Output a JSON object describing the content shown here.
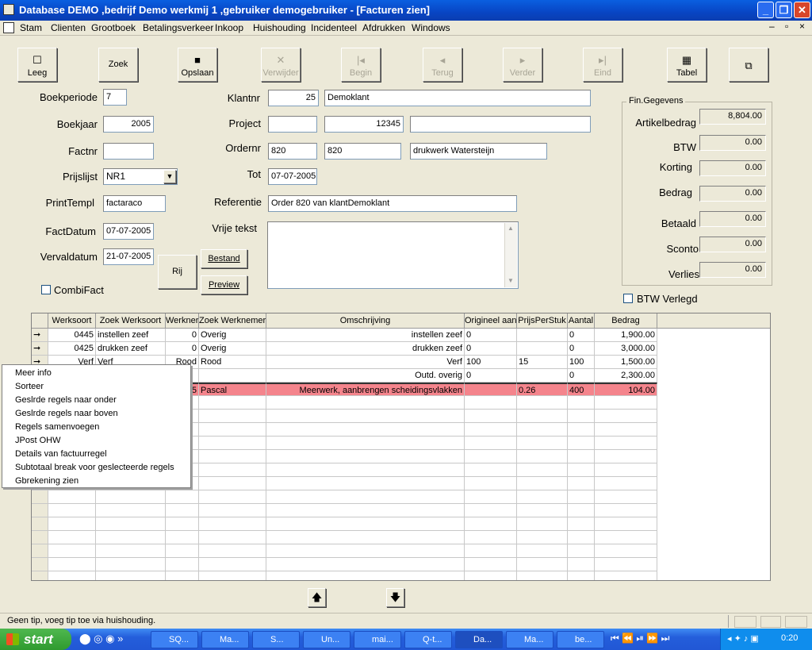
{
  "window": {
    "title": "Database DEMO ,bedrijf Demo werkmij 1 ,gebruiker demogebruiker - [Facturen zien]"
  },
  "menu": [
    "Stam",
    "Clienten",
    "Grootboek",
    "Betalingsverkeer",
    "Inkoop",
    "Huishouding",
    "Incidenteel",
    "Afdrukken",
    "Windows"
  ],
  "toolbar": {
    "leeg": "Leeg",
    "zoek": "Zoek",
    "opslaan": "Opslaan",
    "verwijder": "Verwijder",
    "begin": "Begin",
    "terug": "Terug",
    "verder": "Verder",
    "eind": "Eind",
    "tabel": "Tabel"
  },
  "form": {
    "boekperiode": {
      "label": "Boekperiode",
      "value": "7"
    },
    "boekjaar": {
      "label": "Boekjaar",
      "value": "2005"
    },
    "factnr": {
      "label": "Factnr",
      "value": ""
    },
    "prijslijst": {
      "label": "Prijslijst",
      "value": "NR1"
    },
    "printtempl": {
      "label": "PrintTempl",
      "value": "factaraco"
    },
    "factdatum": {
      "label": "FactDatum",
      "value": "07-07-2005"
    },
    "vervaldatum": {
      "label": "Vervaldatum",
      "value": "21-07-2005"
    },
    "combifact": {
      "label": "CombiFact"
    },
    "klantnr": {
      "label": "Klantnr",
      "value": "25",
      "name": "Demoklant"
    },
    "project": {
      "label": "Project",
      "value": "",
      "code": "12345",
      "desc": ""
    },
    "ordernr": {
      "label": "Ordernr",
      "value": "820",
      "code": "820",
      "desc": "drukwerk Watersteijn"
    },
    "tot": {
      "label": "Tot",
      "value": "07-07-2005"
    },
    "referentie": {
      "label": "Referentie",
      "value": "Order 820 van klantDemoklant"
    },
    "vrijetekst": {
      "label": "Vrije tekst",
      "value": ""
    },
    "rij": "Rij",
    "bestand": "Bestand",
    "preview": "Preview"
  },
  "fin": {
    "title": "Fin.Gegevens",
    "artikelbedrag": {
      "label": "Artikelbedrag",
      "value": "8,804.00"
    },
    "btw": {
      "label": "BTW",
      "value": "0.00"
    },
    "korting": {
      "label": "Korting",
      "value": "0.00"
    },
    "bedrag": {
      "label": "Bedrag",
      "value": "0.00"
    },
    "betaald": {
      "label": "Betaald",
      "value": "0.00"
    },
    "sconto": {
      "label": "Sconto",
      "value": "0.00"
    },
    "verlies": {
      "label": "Verlies",
      "value": "0.00"
    },
    "btwverlegd": "BTW Verlegd"
  },
  "grid": {
    "headers": [
      "Werksoort",
      "Zoek Werksoort",
      "Werkner",
      "Zoek Werknemer",
      "Omschrijving",
      "Origineel aant",
      "PrijsPerStuk",
      "Aantal",
      "Bedrag"
    ],
    "rows": [
      [
        "0445",
        "instellen zeef",
        "0",
        "Overig",
        "instellen zeef",
        "0",
        "",
        "0",
        "1,900.00"
      ],
      [
        "0425",
        "drukken zeef",
        "0",
        "Overig",
        "drukken zeef",
        "0",
        "",
        "0",
        "3,000.00"
      ],
      [
        "Verf",
        "Verf",
        "Rood",
        "Rood",
        "Verf",
        "100",
        "15",
        "100",
        "1,500.00"
      ],
      [
        "",
        "",
        "",
        "",
        "Outd. overig",
        "0",
        "",
        "0",
        "2,300.00"
      ],
      [
        "",
        "",
        "5",
        "Pascal",
        "Meerwerk, aanbrengen scheidingsvlakken",
        "",
        "0.26",
        "400",
        "104.00"
      ]
    ]
  },
  "context_menu": [
    "Meer info",
    "Sorteer",
    "Geslrde regels naar onder",
    "Geslrde regels naar boven",
    "Regels samenvoegen",
    "JPost OHW",
    "Details van factuurregel",
    "Subtotaal break voor geslecteerde regels",
    "Gbrekening zien"
  ],
  "status": "Geen tip, voeg tip toe via huishouding.",
  "taskbar": {
    "start": "start",
    "tasks": [
      "SQ...",
      "Ma...",
      "S...",
      "Un...",
      "mai...",
      "Q-t...",
      "Da...",
      "Ma...",
      "be..."
    ],
    "clock": "0:20"
  }
}
